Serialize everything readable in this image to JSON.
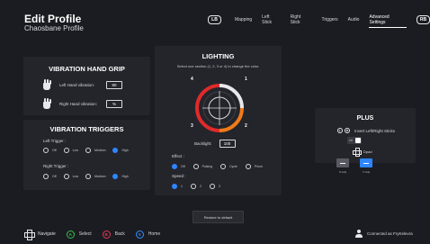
{
  "header": {
    "title": "Edit Profile",
    "subtitle": "Chaosbane Profile",
    "lb": "LB",
    "rb": "RB",
    "tabs": [
      {
        "label": "Mapping"
      },
      {
        "label": "Left Stick"
      },
      {
        "label": "Right Stick"
      },
      {
        "label": "Triggers"
      },
      {
        "label": "Audio"
      },
      {
        "label": "Advanced Settings",
        "active": true
      }
    ]
  },
  "hand_grip": {
    "title": "VIBRATION HAND GRIP",
    "left_label": "Left Hand vibration:",
    "left_value": "80",
    "right_label": "Right Hand vibration:",
    "right_value": "%"
  },
  "triggers": {
    "title": "VIBRATION TRIGGERS",
    "left_label": "Left Trigger :",
    "right_label": "Right Trigger :",
    "options": [
      "Off",
      "Low",
      "Medium",
      "High"
    ],
    "left_selected": "High",
    "right_selected": "High"
  },
  "lighting": {
    "title": "LIGHTING",
    "hint": "Select one section (1, 2, 3 or 4) to change the color.",
    "sections": [
      "1",
      "2",
      "3",
      "4"
    ],
    "backlight_label": "Backlight:",
    "backlight_value": "100",
    "effect_label": "Effect :",
    "effect_options": [
      "Off",
      "Pulsing",
      "Cycle",
      "Prism"
    ],
    "effect_selected": "Off",
    "speed_label": "Speed :",
    "speed_options": [
      "1",
      "2",
      "3"
    ],
    "speed_selected": "1",
    "colors": {
      "section1": "#e8e8ec",
      "section2": "#f07a1a",
      "section3": "#e02a2a",
      "section4": "#e02a2a"
    }
  },
  "plus": {
    "title": "PLUS",
    "stick_left": "L",
    "stick_right": "R",
    "invert_label": "Invert Left/Right Sticks",
    "toggle_label": "Off",
    "dpad_label": "Dpad",
    "options": [
      {
        "label": "X only",
        "selected": false
      },
      {
        "label": "Y only",
        "selected": true
      }
    ]
  },
  "restore_label": "Restore to default",
  "footer": {
    "navigate": "Navigate",
    "select_glyph": "A",
    "select": "Select",
    "back_glyph": "B",
    "back": "Back",
    "home_glyph": "X",
    "home": "Home",
    "connected": "Connected as FryKelevra"
  },
  "accent_color": "#2e86ff"
}
